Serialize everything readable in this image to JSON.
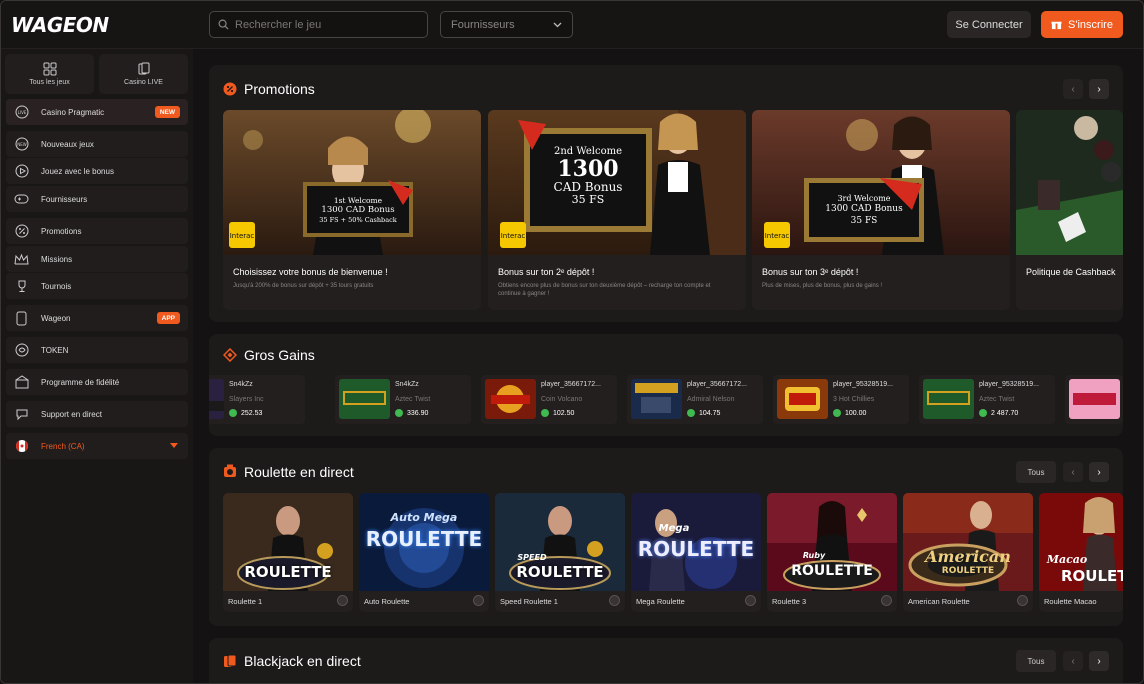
{
  "header": {
    "logo": "WAGEON",
    "search_placeholder": "Rechercher le jeu",
    "providers_label": "Fournisseurs",
    "login_label": "Se Connecter",
    "signup_label": "S'inscrire"
  },
  "sidebar": {
    "tiles": [
      {
        "label": "Tous les jeux",
        "icon": "grid-icon"
      },
      {
        "label": "Casino LIVE",
        "icon": "cards-icon"
      }
    ],
    "items": [
      {
        "label": "Casino Pragmatic",
        "badge": "NEW",
        "icon": "live-icon"
      },
      {
        "label": "Nouveaux jeux",
        "icon": "new-icon"
      },
      {
        "label": "Jouez avec le bonus",
        "icon": "play-icon"
      },
      {
        "label": "Fournisseurs",
        "icon": "gamepad-icon"
      },
      {
        "label": "Promotions",
        "icon": "percent-icon"
      },
      {
        "label": "Missions",
        "icon": "crown-icon"
      },
      {
        "label": "Tournois",
        "icon": "trophy-icon"
      },
      {
        "label": "Wageon",
        "badge": "APP",
        "icon": "phone-icon"
      },
      {
        "label": "TOKEN",
        "icon": "token-icon"
      },
      {
        "label": "Programme de fidélité",
        "icon": "loyalty-icon"
      },
      {
        "label": "Support en direct",
        "icon": "support-icon"
      }
    ],
    "language": "French (CA)"
  },
  "promotions": {
    "title": "Promotions",
    "cards": [
      {
        "title": "Choisissez votre bonus de bienvenue !",
        "desc": "Jusqu'à 200% de bonus sur dépôt + 35 tours gratuits",
        "sign_1": "1st Welcome",
        "sign_2": "1300 CAD Bonus",
        "sign_3": "35 FS + 50% Cashback"
      },
      {
        "title": "Bonus sur ton 2ᵉ dépôt !",
        "desc": "Obtiens encore plus de bonus sur ton deuxième dépôt – recharge ton compte et continue à gagner !",
        "sign_1": "2nd Welcome",
        "sign_2": "1300",
        "sign_3": "CAD Bonus",
        "sign_4": "35 FS"
      },
      {
        "title": "Bonus sur ton 3ᵉ dépôt !",
        "desc": "Plus de mises, plus de bonus, plus de gains !",
        "sign_1": "3rd Welcome",
        "sign_2": "1300 CAD Bonus",
        "sign_3": "35 FS"
      },
      {
        "title": "Politique de Cashback",
        "desc": ""
      }
    ],
    "interac": "Interac"
  },
  "big_wins": {
    "title": "Gros Gains",
    "items": [
      {
        "user": "Sn4kZz",
        "game": "Slayers Inc",
        "amount": "252.53"
      },
      {
        "user": "Sn4kZz",
        "game": "Aztec Twist",
        "amount": "336.90"
      },
      {
        "user": "player_35667172...",
        "game": "Coin Volcano",
        "amount": "102.50"
      },
      {
        "user": "player_35667172...",
        "game": "Admiral Nelson",
        "amount": "104.75"
      },
      {
        "user": "player_95328519...",
        "game": "3 Hot Chillies",
        "amount": "100.00"
      },
      {
        "user": "player_95328519...",
        "game": "Aztec Twist",
        "amount": "2 487.70"
      }
    ]
  },
  "roulette": {
    "title": "Roulette en direct",
    "all_label": "Tous",
    "games": [
      {
        "name": "Roulette 1",
        "logo": "ROULETTE"
      },
      {
        "name": "Auto Roulette",
        "logo": "ROULETTE",
        "sub": "Auto Mega"
      },
      {
        "name": "Speed Roulette 1",
        "logo": "ROULETTE",
        "sub": "SPEED"
      },
      {
        "name": "Mega Roulette",
        "logo": "ROULETTE",
        "sub": "Mega"
      },
      {
        "name": "Roulette 3",
        "logo": "ROULETTE",
        "sub": "Ruby"
      },
      {
        "name": "American Roulette",
        "logo": "ROULETTE",
        "sub": "American"
      },
      {
        "name": "Roulette Macao",
        "logo": "ROULETTE",
        "sub": "Macao"
      }
    ]
  },
  "blackjack": {
    "title": "Blackjack en direct",
    "all_label": "Tous"
  }
}
